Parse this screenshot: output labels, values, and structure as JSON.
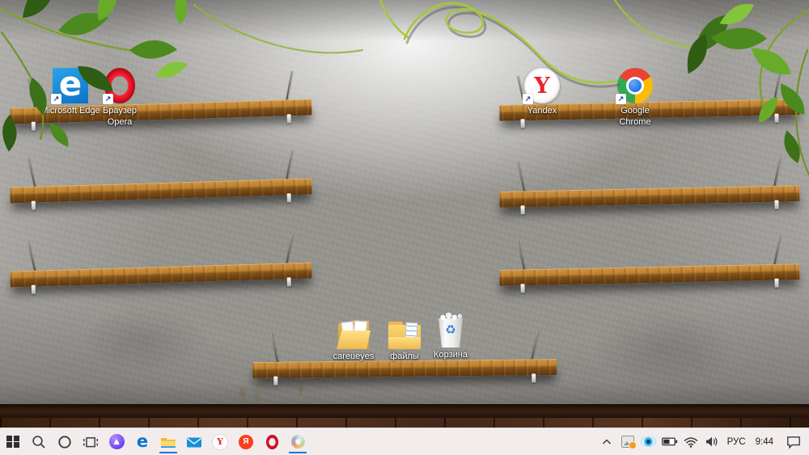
{
  "desktop": {
    "icons": [
      {
        "name": "microsoft-edge",
        "label": "Microsoft Edge",
        "type": "browser-shortcut"
      },
      {
        "name": "opera",
        "label": "Браузер Opera",
        "type": "browser-shortcut"
      },
      {
        "name": "yandex-browser",
        "label": "Yandex",
        "type": "browser-shortcut"
      },
      {
        "name": "google-chrome",
        "label": "Google Chrome",
        "type": "browser-shortcut"
      },
      {
        "name": "careueyes-folder",
        "label": "careueyes",
        "type": "folder"
      },
      {
        "name": "files-folder",
        "label": "файлы",
        "type": "folder"
      },
      {
        "name": "recycle-bin",
        "label": "Корзина",
        "type": "recycle-bin"
      }
    ],
    "wallpaper": "wooden shelves on concrete wall with green vines and spotlight"
  },
  "glyphs": {
    "edge": "e",
    "yandex": "Y",
    "yandex_app": "Я",
    "recycle": "♻"
  },
  "taskbar": {
    "buttons": [
      {
        "name": "start",
        "icon": "windows-logo-icon",
        "running": false
      },
      {
        "name": "search",
        "icon": "search-icon",
        "running": false
      },
      {
        "name": "cortana",
        "icon": "circle-icon",
        "running": false
      },
      {
        "name": "task-view",
        "icon": "task-view-icon",
        "running": false
      },
      {
        "name": "alisa-assistant",
        "icon": "alisa-icon",
        "running": false
      },
      {
        "name": "edge",
        "icon": "edge-e-icon",
        "running": false
      },
      {
        "name": "file-explorer",
        "icon": "folder-icon",
        "running": true
      },
      {
        "name": "mail",
        "icon": "envelope-icon",
        "running": false
      },
      {
        "name": "yandex-browser",
        "icon": "yandex-y-icon",
        "running": false
      },
      {
        "name": "yandex-app",
        "icon": "yandex-ya-icon",
        "running": false
      },
      {
        "name": "opera",
        "icon": "opera-ring-icon",
        "running": false
      },
      {
        "name": "colorful-app",
        "icon": "colorful-swirl-icon",
        "running": true
      }
    ],
    "tray": {
      "icons": [
        "hidden-icons-chevron",
        "tray-app-with-notification",
        "careueyes-eye",
        "battery",
        "wifi",
        "volume"
      ],
      "language": "РУС",
      "time": "9:44"
    }
  },
  "colors": {
    "taskbar_bg": "#f2edec",
    "running_underline": "#0c7ad8",
    "wall": "#96948f",
    "shelf_wood": "#bb7f2f",
    "floor": "#45281a",
    "edge_blue": "#0b72c8",
    "opera_red": "#e5182d",
    "yandex_red": "#e8242c",
    "chrome_colors": [
      "#ea4335",
      "#fbbc05",
      "#34a853",
      "#1a73e8"
    ],
    "alisa_purple": "#6d3ff0",
    "folder_yellow": "#f7c64c",
    "recycle_blue": "#2d7fd3",
    "notification_orange": "#f49b1b",
    "eye_blue": "#2fb2e8",
    "vine_green": "#a3c93a"
  }
}
